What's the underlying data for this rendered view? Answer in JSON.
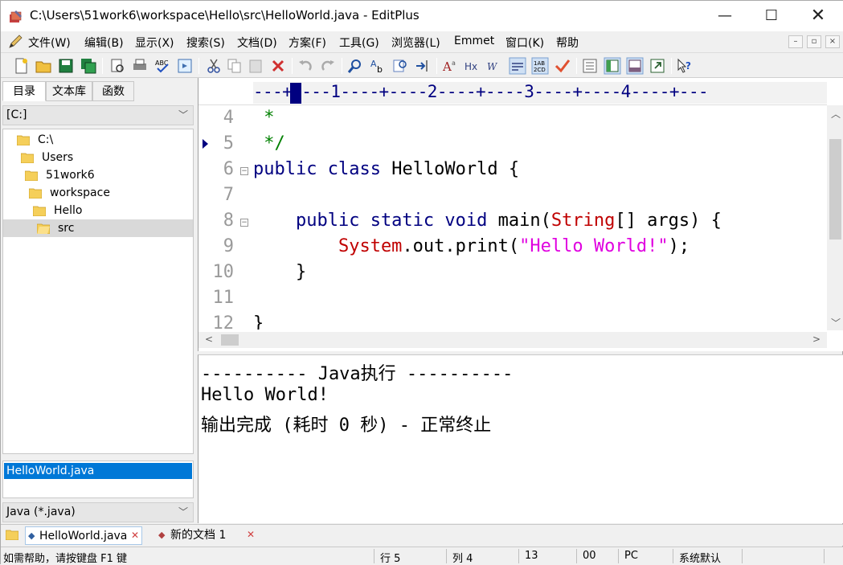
{
  "window": {
    "title": "C:\\Users\\51work6\\workspace\\Hello\\src\\HelloWorld.java - EditPlus",
    "minimize": "—",
    "maximize": "☐",
    "close": "✕"
  },
  "menu": [
    "文件(W)",
    "编辑(B)",
    "显示(X)",
    "搜索(S)",
    "文档(D)",
    "方案(F)",
    "工具(G)",
    "浏览器(L)",
    "Emmet",
    "窗口(K)",
    "帮助"
  ],
  "mdi": [
    "–",
    "▫",
    "×"
  ],
  "left_pane": {
    "tabs": [
      "目录",
      "文本库",
      "函数"
    ],
    "drive": "[C:]",
    "tree": [
      "C:\\",
      "Users",
      "51work6",
      "workspace",
      "Hello",
      "src"
    ],
    "selected_file": "HelloWorld.java",
    "filter": "Java (*.java)"
  },
  "editor": {
    "ruler": "---+----1----+----2----+----3----+----4----+---",
    "line_numbers": [
      "4",
      "5",
      "6",
      "7",
      "8",
      "9",
      "10",
      "11",
      "12"
    ],
    "code": {
      "l4": " *",
      "l5": " */",
      "l6_kw": "public class",
      "l6_rest": " HelloWorld {",
      "l8_kw": "    public static void",
      "l8_name": " main(",
      "l8_type": "String",
      "l8_rest": "[] args) {",
      "l9_type": "        System",
      "l9_mid": ".out.print(",
      "l9_str": "\"Hello World!\"",
      "l9_end": ");",
      "l10": "    }",
      "l12": "}"
    }
  },
  "output": {
    "header": "---------- Java执行 ----------",
    "result": "Hello World!",
    "footer": "输出完成 (耗时 0 秒) - 正常终止"
  },
  "doc_tabs": [
    "HelloWorld.java",
    "新的文档 1"
  ],
  "status": {
    "help": "如需帮助，请按键盘 F1 键",
    "line": "行 5",
    "col": "列 4",
    "n13": "13",
    "n00": "00",
    "pc": "PC",
    "encoding": "系统默认"
  },
  "colors": {
    "keyword": "#000080",
    "comment": "#008000",
    "type": "#c00000",
    "string": "#e000e0",
    "selection": "#0078d7"
  }
}
